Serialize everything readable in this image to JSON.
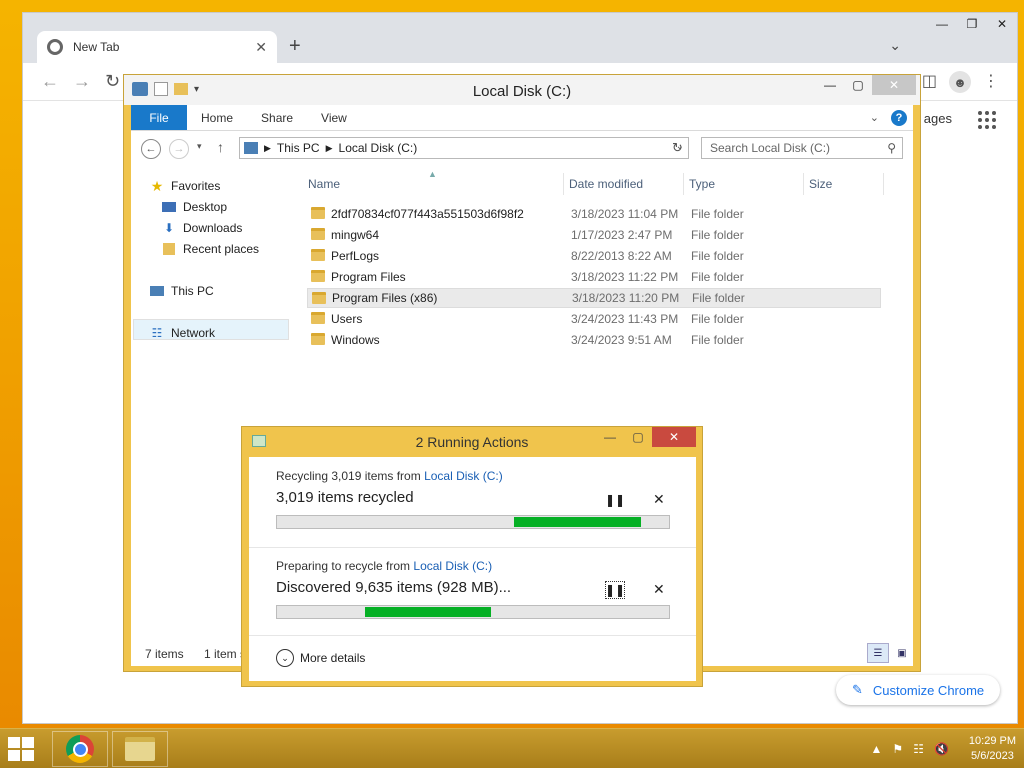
{
  "chrome": {
    "tab_title": "New Tab",
    "partial_link": "ages",
    "customize_label": "Customize Chrome"
  },
  "explorer": {
    "title": "Local Disk (C:)",
    "ribbon": {
      "file": "File",
      "home": "Home",
      "share": "Share",
      "view": "View"
    },
    "address": {
      "this_pc": "This PC",
      "local_disk": "Local Disk (C:)"
    },
    "search_placeholder": "Search Local Disk (C:)",
    "nav": {
      "favorites": "Favorites",
      "desktop": "Desktop",
      "downloads": "Downloads",
      "recent": "Recent places",
      "this_pc": "This PC",
      "network": "Network"
    },
    "columns": {
      "name": "Name",
      "date": "Date modified",
      "type": "Type",
      "size": "Size"
    },
    "rows": [
      {
        "name": "2fdf70834cf077f443a551503d6f98f2",
        "date": "3/18/2023 11:04 PM",
        "type": "File folder"
      },
      {
        "name": "mingw64",
        "date": "1/17/2023 2:47 PM",
        "type": "File folder"
      },
      {
        "name": "PerfLogs",
        "date": "8/22/2013 8:22 AM",
        "type": "File folder"
      },
      {
        "name": "Program Files",
        "date": "3/18/2023 11:22 PM",
        "type": "File folder"
      },
      {
        "name": "Program Files (x86)",
        "date": "3/18/2023 11:20 PM",
        "type": "File folder"
      },
      {
        "name": "Users",
        "date": "3/24/2023 11:43 PM",
        "type": "File folder"
      },
      {
        "name": "Windows",
        "date": "3/24/2023 9:51 AM",
        "type": "File folder"
      }
    ],
    "status": {
      "count": "7 items",
      "selected": "1 item s"
    }
  },
  "dialog": {
    "title": "2 Running Actions",
    "op1": {
      "prefix": "Recycling 3,019 items from ",
      "link": "Local Disk (C:)",
      "detail": "3,019 items recycled",
      "progress_start": 0.605,
      "progress_end": 0.929
    },
    "op2": {
      "prefix": "Preparing to recycle from ",
      "link": "Local Disk (C:)",
      "detail": "Discovered 9,635 items (928 MB)...",
      "progress_start": 0.224,
      "progress_end": 0.546
    },
    "more_details": "More details"
  },
  "taskbar": {
    "time": "10:29 PM",
    "date": "5/6/2023"
  },
  "colors": {
    "accent": "#1979ca",
    "progress": "#06b025",
    "desktop": "#f0a500"
  }
}
